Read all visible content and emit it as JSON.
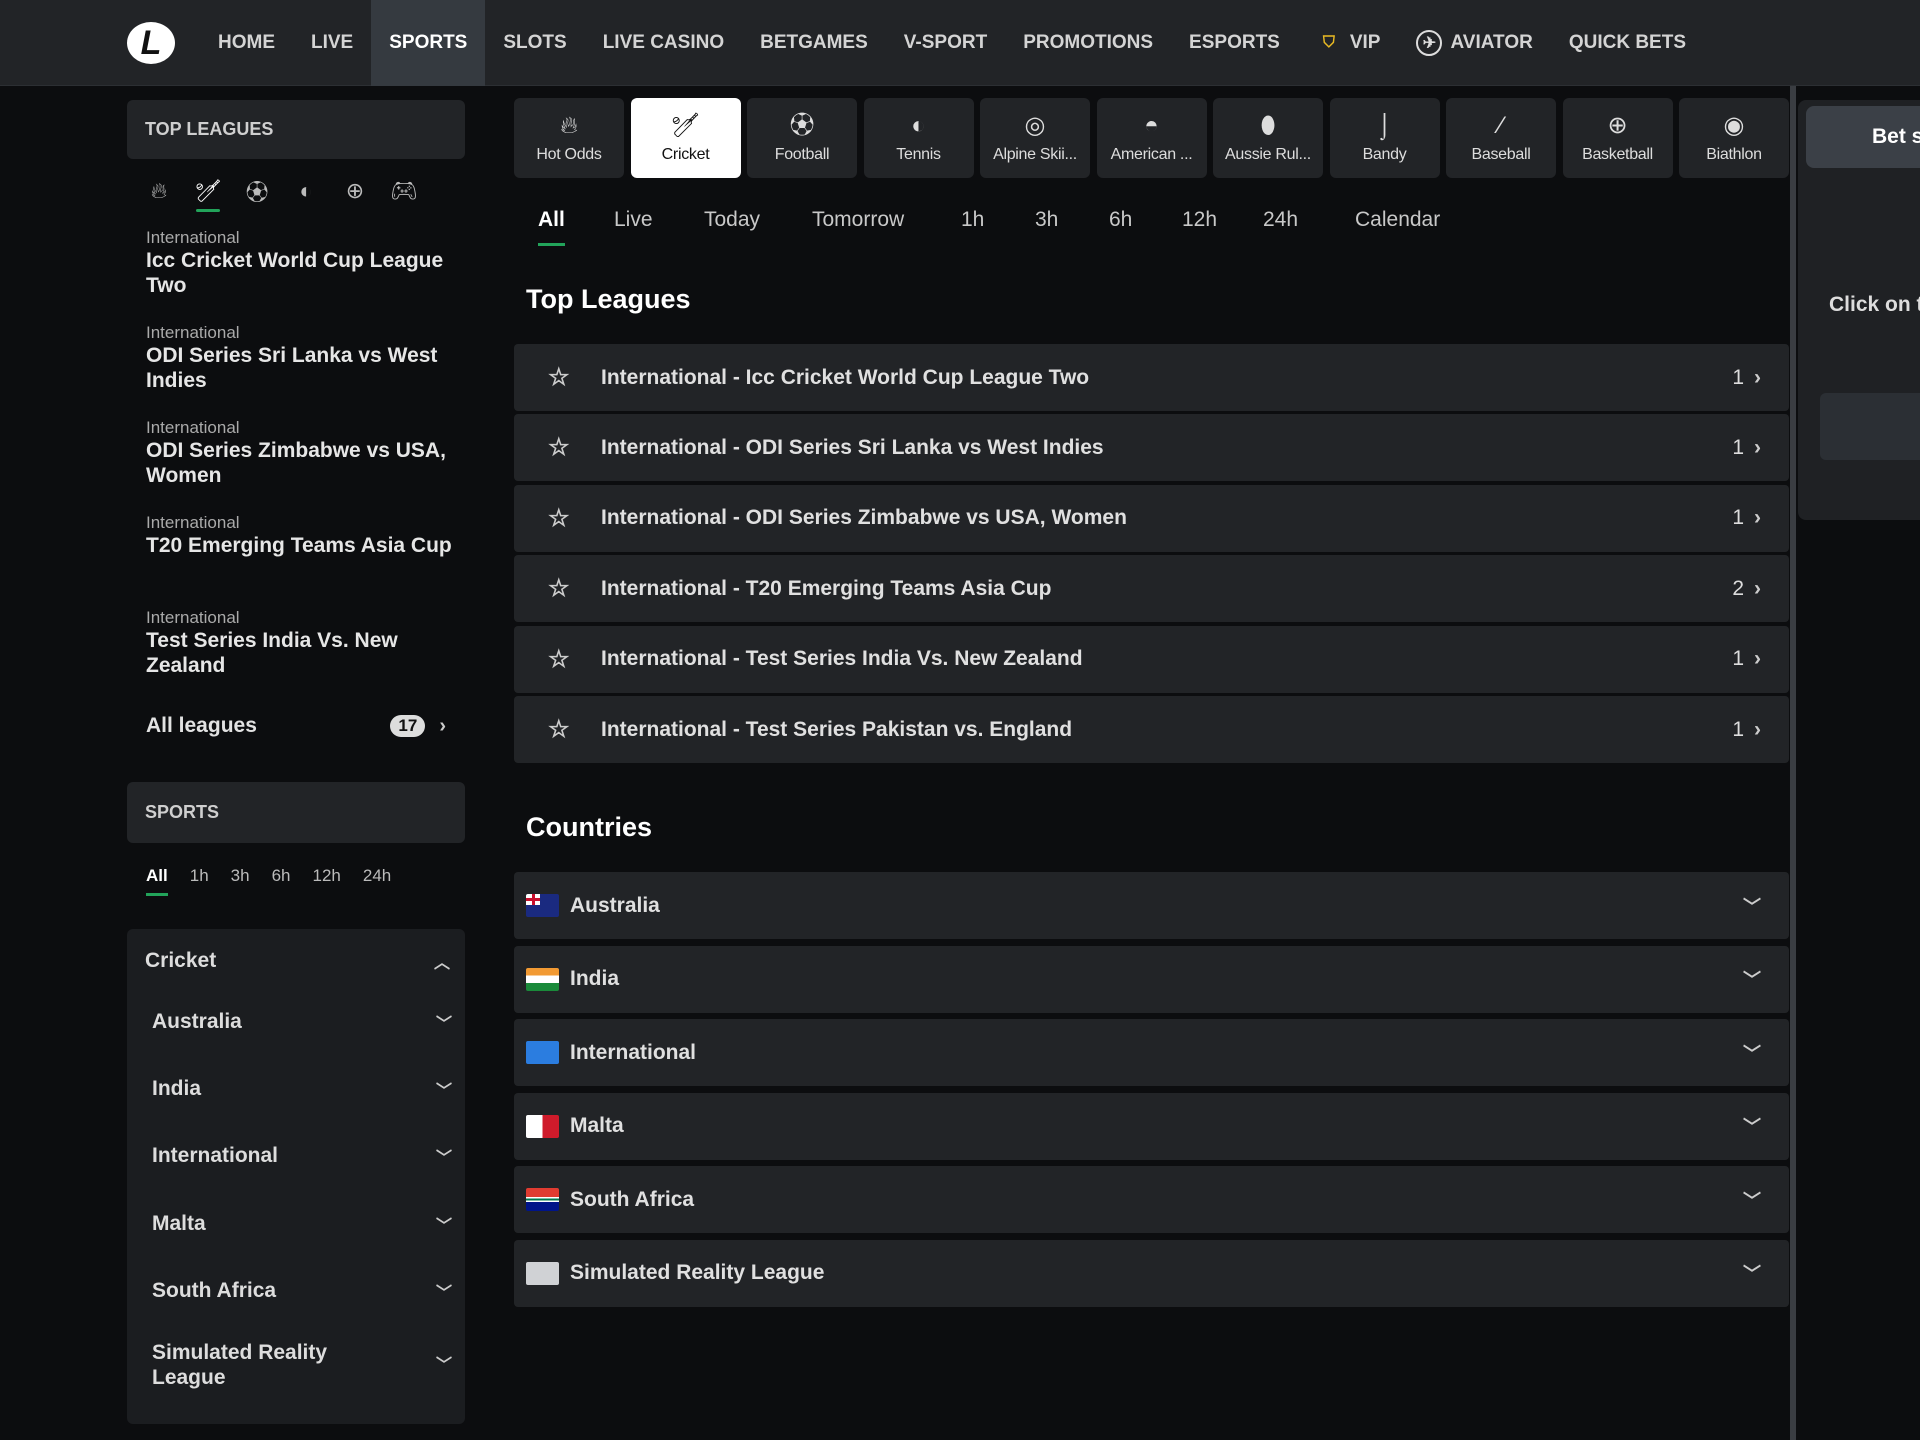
{
  "colors": {
    "accent": "#22a35a",
    "header": "#222427",
    "background": "#0c0d0f",
    "vip": "#e8b923"
  },
  "header": {
    "logo": "L",
    "nav": [
      {
        "label": "HOME"
      },
      {
        "label": "LIVE"
      },
      {
        "label": "SPORTS",
        "active": true
      },
      {
        "label": "SLOTS"
      },
      {
        "label": "LIVE CASINO"
      },
      {
        "label": "BETGAMES"
      },
      {
        "label": "V-SPORT"
      },
      {
        "label": "PROMOTIONS"
      },
      {
        "label": "ESPORTS"
      },
      {
        "label": "VIP",
        "icon": "vip-shield-icon"
      },
      {
        "label": "AVIATOR",
        "icon": "aviator-icon"
      },
      {
        "label": "QUICK BETS"
      }
    ]
  },
  "sidebar": {
    "top_leagues_title": "TOP LEAGUES",
    "sport_icons": [
      "fire-icon",
      "cricket-icon",
      "football-icon",
      "tennis-icon",
      "basketball-icon",
      "gamepad-icon"
    ],
    "active_icon": 1,
    "leagues": [
      {
        "category": "International",
        "name": "Icc Cricket World Cup League Two"
      },
      {
        "category": "International",
        "name": "ODI Series Sri Lanka vs West Indies"
      },
      {
        "category": "International",
        "name": "ODI Series Zimbabwe vs USA, Women"
      },
      {
        "category": "International",
        "name": "T20 Emerging Teams Asia Cup"
      },
      {
        "category": "International",
        "name": "Test Series India Vs. New Zealand"
      }
    ],
    "all_leagues_label": "All leagues",
    "all_leagues_count": "17",
    "sports_title": "SPORTS",
    "time_filters": [
      "All",
      "1h",
      "3h",
      "6h",
      "12h",
      "24h"
    ],
    "cricket": {
      "title": "Cricket",
      "countries": [
        "Australia",
        "India",
        "International",
        "Malta",
        "South Africa",
        "Simulated Reality League"
      ]
    }
  },
  "main": {
    "sports": [
      {
        "label": "Hot Odds",
        "icon": "fire-icon"
      },
      {
        "label": "Cricket",
        "icon": "cricket-icon",
        "active": true
      },
      {
        "label": "Football",
        "icon": "football-icon"
      },
      {
        "label": "Tennis",
        "icon": "tennis-icon"
      },
      {
        "label": "Alpine Skii...",
        "icon": "ski-goggles-icon"
      },
      {
        "label": "American ...",
        "icon": "helmet-icon"
      },
      {
        "label": "Aussie Rul...",
        "icon": "rugby-ball-icon"
      },
      {
        "label": "Bandy",
        "icon": "bandy-stick-icon"
      },
      {
        "label": "Baseball",
        "icon": "baseball-bat-icon"
      },
      {
        "label": "Basketball",
        "icon": "basketball-icon"
      },
      {
        "label": "Biathlon",
        "icon": "target-icon"
      }
    ],
    "tabs": [
      "All",
      "Live",
      "Today",
      "Tomorrow",
      "1h",
      "3h",
      "6h",
      "12h",
      "24h",
      "Calendar"
    ],
    "top_leagues_title": "Top Leagues",
    "top_leagues": [
      {
        "name": "International - Icc Cricket World Cup League Two",
        "count": "1"
      },
      {
        "name": "International - ODI Series Sri Lanka vs West Indies",
        "count": "1"
      },
      {
        "name": "International - ODI Series Zimbabwe vs USA, Women",
        "count": "1"
      },
      {
        "name": "International - T20 Emerging Teams Asia Cup",
        "count": "2"
      },
      {
        "name": "International - Test Series India Vs. New Zealand",
        "count": "1"
      },
      {
        "name": "International - Test Series Pakistan vs. England",
        "count": "1"
      }
    ],
    "countries_title": "Countries",
    "countries": [
      {
        "name": "Australia",
        "flag": "australia"
      },
      {
        "name": "India",
        "flag": "india"
      },
      {
        "name": "International",
        "flag": "world"
      },
      {
        "name": "Malta",
        "flag": "malta"
      },
      {
        "name": "South Africa",
        "flag": "south-africa"
      },
      {
        "name": "Simulated Reality League",
        "flag": "globe"
      }
    ]
  },
  "betslip": {
    "button": "Bet s",
    "message": "Click on t"
  }
}
